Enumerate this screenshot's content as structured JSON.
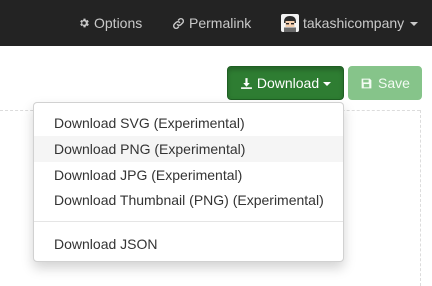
{
  "navbar": {
    "options_label": "Options",
    "permalink_label": "Permalink",
    "username": "takashicompany"
  },
  "toolbar": {
    "download_label": "Download",
    "save_label": "Save"
  },
  "download_menu": {
    "items": [
      "Download SVG (Experimental)",
      "Download PNG (Experimental)",
      "Download JPG (Experimental)",
      "Download Thumbnail (PNG) (Experimental)"
    ],
    "json_item": "Download JSON",
    "highlighted_item": "Download PNG (Experimental)"
  },
  "colors": {
    "navbar_bg": "#232323",
    "download_button": "#2e7d32",
    "save_button_disabled": "#86c48a"
  }
}
